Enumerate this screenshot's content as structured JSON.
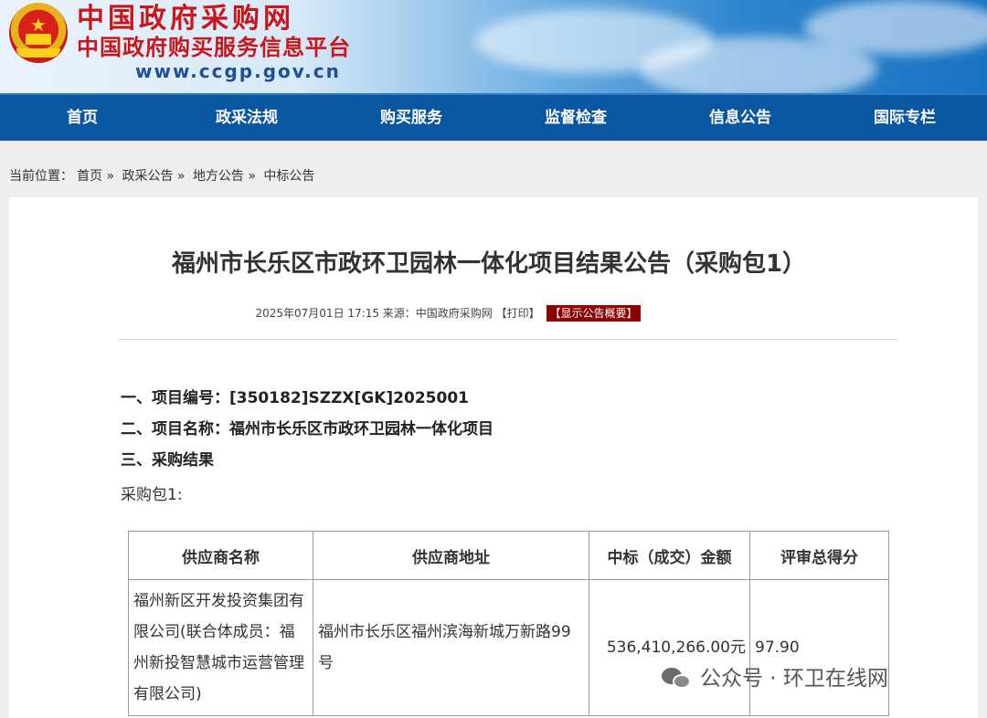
{
  "header": {
    "title": "中国政府采购网",
    "subtitle": "中国政府购买服务信息平台",
    "url": "www.ccgp.gov.cn",
    "emblem_icon": "national-emblem"
  },
  "nav": {
    "items": [
      "首页",
      "政采法规",
      "购买服务",
      "监督检查",
      "信息公告",
      "国际专栏"
    ]
  },
  "breadcrumb": {
    "label": "当前位置：",
    "items": [
      "首页 »",
      "政采公告 »",
      "地方公告 »",
      "中标公告"
    ]
  },
  "article": {
    "title": "福州市长乐区市政环卫园林一体化项目结果公告（采购包1）",
    "datetime": "2025年07月01日 17:15",
    "source": "来源：中国政府采购网",
    "print_label": "【打印】",
    "summary_label": "【显示公告概要】",
    "sections": [
      "一、项目编号：[350182]SZZX[GK]2025001",
      "二、项目名称：福州市长乐区市政环卫园林一体化项目",
      "三、采购结果"
    ],
    "package_label": "采购包1:"
  },
  "table": {
    "headers": [
      "供应商名称",
      "供应商地址",
      "中标（成交）金额",
      "评审总得分"
    ],
    "rows": [
      {
        "name": "福州新区开发投资集团有限公司(联合体成员：福州新投智慧城市运营管理有限公司)",
        "address": "福州市长乐区福州滨海新城万新路99号",
        "amount": "536,410,266.00元",
        "score": "97.90"
      }
    ]
  },
  "watermark": {
    "text": "公众号 · 环卫在线网",
    "icon": "wechat-icon"
  },
  "colors": {
    "nav_bg": "#0b56a0",
    "title_red": "#c8161d",
    "tag_bg": "#8b0000"
  }
}
